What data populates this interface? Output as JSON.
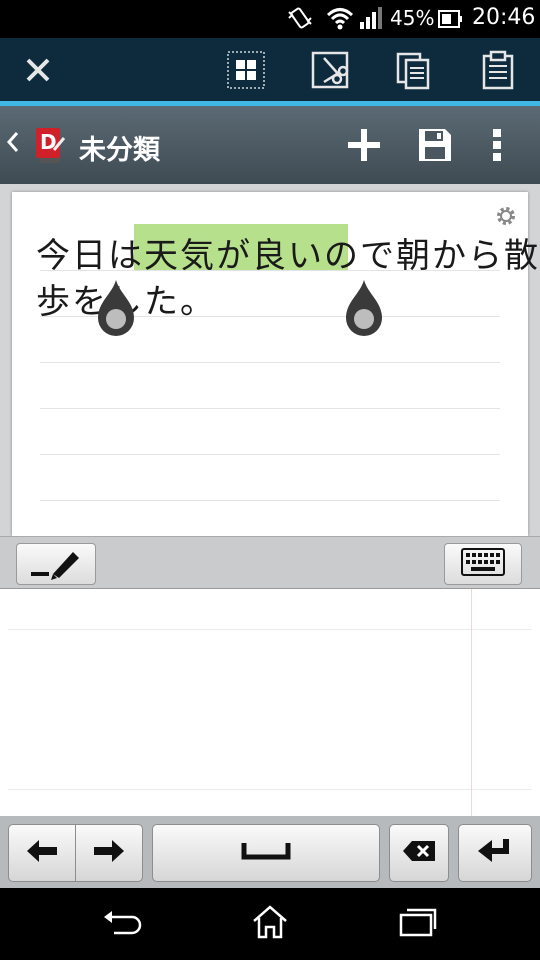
{
  "status_bar": {
    "battery_percent": "45%",
    "time": "20:46",
    "icons": [
      "vibrate-icon",
      "wifi-icon",
      "signal-icon",
      "battery-icon"
    ]
  },
  "action_bar": {
    "accent_color": "#3fb8e6",
    "icons": [
      "close-icon",
      "select-all-icon",
      "cut-icon",
      "copy-icon",
      "paste-icon"
    ]
  },
  "title_bar": {
    "title": "未分類",
    "logo_letter": "D",
    "icons": [
      "back-chevron-icon",
      "app-logo-icon",
      "add-icon",
      "save-icon",
      "overflow-menu-icon"
    ]
  },
  "note": {
    "line1_before": "今日は",
    "line1_selected": "天気が良いので",
    "line1_after": "朝から散",
    "line2": "歩をした。",
    "highlight_color": "#b7e08c"
  },
  "input_panel": {
    "icons": [
      "pen-icon",
      "keyboard-icon"
    ]
  },
  "keyboard": {
    "icons": [
      "arrow-left-icon",
      "arrow-right-icon",
      "space-icon",
      "backspace-icon",
      "enter-icon"
    ]
  },
  "nav_bar": {
    "icons": [
      "back-icon",
      "home-icon",
      "recent-apps-icon"
    ]
  }
}
